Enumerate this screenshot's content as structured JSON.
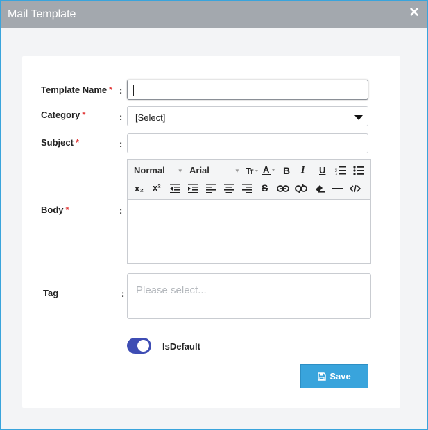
{
  "dialog": {
    "title": "Mail Template",
    "close_label": "✕"
  },
  "form": {
    "required_mark": "*",
    "colon": ":",
    "template_name": {
      "label": "Template Name",
      "value": ""
    },
    "category": {
      "label": "Category",
      "selected": "[Select]"
    },
    "subject": {
      "label": "Subject",
      "value": ""
    },
    "body": {
      "label": "Body",
      "font_style": "Normal",
      "font_family": "Arial",
      "toolbar": {
        "bold": "B",
        "italic": "I",
        "underline": "U",
        "subscript": "x₂",
        "superscript": "x²",
        "strike": "S"
      }
    },
    "tag": {
      "label": "Tag",
      "placeholder": "Please select..."
    },
    "is_default": {
      "label": "IsDefault",
      "checked": true
    },
    "save_label": "Save"
  },
  "colors": {
    "accent": "#39a4dc",
    "toggle": "#3e4db4",
    "required": "#e23b3b",
    "titlebar": "#a3a8ae"
  }
}
